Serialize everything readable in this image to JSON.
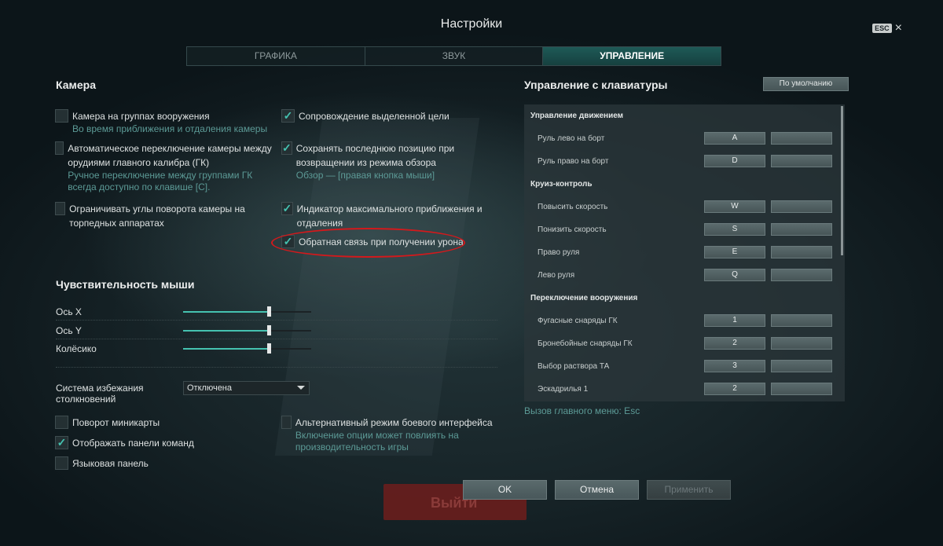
{
  "title": "Настройки",
  "esc": {
    "badge": "ESC",
    "close": "×"
  },
  "tabs": [
    {
      "label": "ГРАФИКА",
      "active": false
    },
    {
      "label": "ЗВУК",
      "active": false
    },
    {
      "label": "УПРАВЛЕНИЕ",
      "active": true
    }
  ],
  "camera": {
    "heading": "Камера",
    "left": [
      {
        "label": "Камера на группах вооружения",
        "sub": "Во время приближения и отдаления камеры",
        "checked": false
      },
      {
        "label": "Автоматическое переключение камеры между орудиями главного калибра (ГК)",
        "sub": "Ручное переключение между группами ГК всегда доступно по клавише [C].",
        "checked": false
      },
      {
        "label": "Ограничивать углы поворота камеры на торпедных аппаратах",
        "sub": "",
        "checked": false
      }
    ],
    "right": [
      {
        "label": "Сопровождение выделенной цели",
        "sub": "",
        "checked": true
      },
      {
        "label": "Сохранять последнюю позицию при возвращении из режима обзора",
        "sub": "Обзор — [правая кнопка мыши]",
        "checked": true
      },
      {
        "label": "Индикатор максимального приближения и отдаления",
        "sub": "",
        "checked": true
      },
      {
        "label": "Обратная связь при получении урона",
        "sub": "",
        "checked": true
      }
    ]
  },
  "mouse": {
    "heading": "Чувствительность мыши",
    "sliders": [
      {
        "label": "Ось X",
        "value": 0.67
      },
      {
        "label": "Ось Y",
        "value": 0.67
      },
      {
        "label": "Колёсико",
        "value": 0.67
      }
    ]
  },
  "collision": {
    "label": "Система избежания столкновений",
    "value": "Отключена"
  },
  "misc_left": [
    {
      "label": "Поворот миникарты",
      "checked": false
    },
    {
      "label": "Отображать панели команд",
      "checked": true
    },
    {
      "label": "Языковая панель",
      "checked": false
    }
  ],
  "misc_right": {
    "label": "Альтернативный режим боевого интерфейса",
    "sub": "Включение опции может повлиять на производительность игры",
    "checked": false
  },
  "keyboard": {
    "heading": "Управление с клавиатуры",
    "default_button": "По умолчанию",
    "rows": [
      {
        "type": "category",
        "label": "Управление движением"
      },
      {
        "type": "action",
        "label": "Руль лево на борт",
        "key1": "A",
        "key2": ""
      },
      {
        "type": "action",
        "label": "Руль право на борт",
        "key1": "D",
        "key2": ""
      },
      {
        "type": "category",
        "label": "Круиз-контроль"
      },
      {
        "type": "action",
        "label": "Повысить скорость",
        "key1": "W",
        "key2": ""
      },
      {
        "type": "action",
        "label": "Понизить скорость",
        "key1": "S",
        "key2": ""
      },
      {
        "type": "action",
        "label": "Право руля",
        "key1": "E",
        "key2": ""
      },
      {
        "type": "action",
        "label": "Лево руля",
        "key1": "Q",
        "key2": ""
      },
      {
        "type": "category",
        "label": "Переключение вооружения"
      },
      {
        "type": "action",
        "label": "Фугасные снаряды ГК",
        "key1": "1",
        "key2": ""
      },
      {
        "type": "action",
        "label": "Бронебойные снаряды ГК",
        "key1": "2",
        "key2": ""
      },
      {
        "type": "action",
        "label": "Выбор раствора ТА",
        "key1": "3",
        "key2": ""
      },
      {
        "type": "action",
        "label": "Эскадрилья 1",
        "key1": "2",
        "key2": ""
      }
    ],
    "menu_hint": "Вызов главного меню: Esc"
  },
  "buttons": {
    "ok": "OK",
    "cancel": "Отмена",
    "apply": "Применить"
  },
  "background_button": "Выйти",
  "colors": {
    "accent": "#45c2b0",
    "tab_active": "#1e5a57",
    "highlight": "#d3191c",
    "hint": "#5c9a96"
  }
}
